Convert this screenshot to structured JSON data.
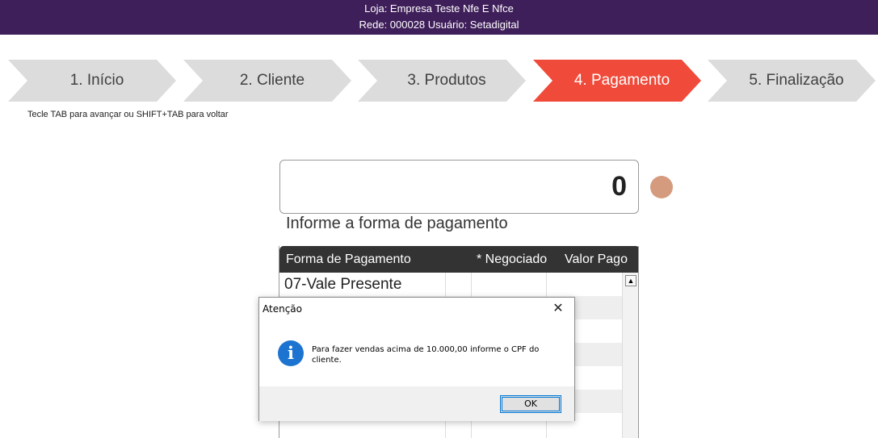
{
  "header": {
    "store_line": "Loja: Empresa Teste Nfe E Nfce",
    "network_line": "Rede: 000028 Usuário: Setadigital"
  },
  "steps": [
    {
      "label": "1. Início",
      "active": false
    },
    {
      "label": "2. Cliente",
      "active": false
    },
    {
      "label": "3. Produtos",
      "active": false
    },
    {
      "label": "4. Pagamento",
      "active": true
    },
    {
      "label": "5. Finalização",
      "active": false
    }
  ],
  "hint": "Tecle TAB para avançar ou SHIFT+TAB para voltar",
  "payment": {
    "amount": "0",
    "prompt": "Informe a forma de pagamento"
  },
  "grid": {
    "columns": [
      "Forma de Pagamento",
      "* Negociado",
      "Valor Pago"
    ],
    "rows": [
      {
        "forma": "07-Vale Presente",
        "negociado": "",
        "valor": ""
      }
    ]
  },
  "dialog": {
    "title": "Atenção",
    "message": "Para fazer vendas acima de 10.000,00 informe o CPF do cliente.",
    "ok_label": "OK",
    "close_glyph": "✕"
  },
  "colors": {
    "header_bg": "#3f1f5a",
    "active_step": "#f04a3a",
    "inactive_step": "#dcdcdc",
    "status_dot": "#d49b7e",
    "info_icon": "#1c74d0"
  }
}
